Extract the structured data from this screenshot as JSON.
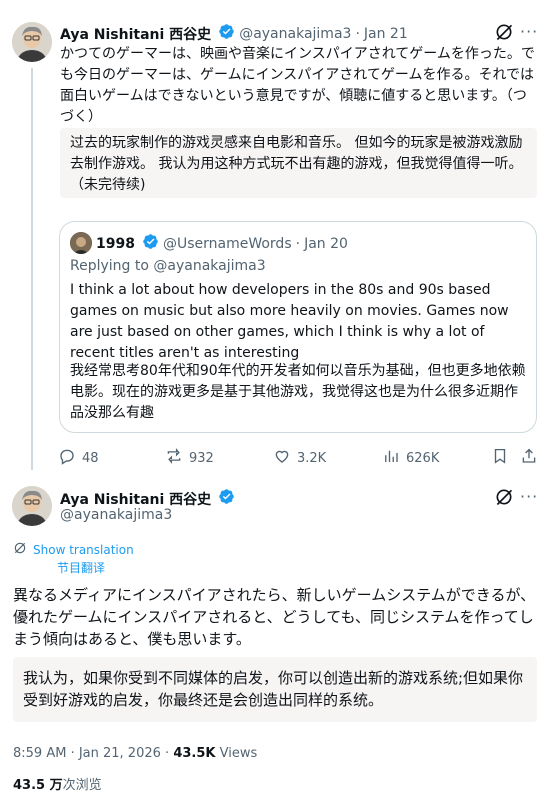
{
  "tweet1": {
    "author_name": "Aya Nishitani 西谷史",
    "handle": "@ayanakajima3",
    "sep": "·",
    "date": "Jan 21",
    "text": "かつてのゲーマーは、映画や音楽にインスパイアされてゲームを作った。でも今日のゲーマーは、ゲームにインスパイアされてゲームを作る。それでは面白いゲームはできないという意見ですが、傾聴に値すると思います。（つづく）",
    "translation": "过去的玩家制作的游戏灵感来自电影和音乐。 但如今的玩家是被游戏激励去制作游戏。 我认为用这种方式玩不出有趣的游戏，但我觉得值得一听。（未完待续)"
  },
  "quote": {
    "author_name": "1998",
    "handle": "@UsernameWords",
    "sep": "·",
    "date": "Jan 20",
    "replying_to": "Replying to @ayanakajima3",
    "text": "I think a lot about how developers in the 80s and 90s based games on music but also more heavily on movies. Games now are just based on other games, which I think is why a lot of recent titles aren't as interesting",
    "translation": "我经常思考80年代和90年代的开发者如何以音乐为基础，但也更多地依赖电影。现在的游戏更多是基于其他游戏，我觉得这也是为什么很多近期作品没那么有趣"
  },
  "actions": {
    "replies": "48",
    "reposts": "932",
    "likes": "3.2K",
    "views": "626K"
  },
  "tweet2": {
    "author_name": "Aya Nishitani 西谷史",
    "handle": "@ayanakajima3",
    "show_translation": "Show translation",
    "show_translation_cn": "节目翻译",
    "text": "異なるメディアにインスパイアされたら、新しいゲームシステムができるが、優れたゲームにインスパイアされると、どうしても、同じシステムを作ってしまう傾向はあると、僕も思います。",
    "translation": "我认为，如果你受到不同媒体的启发，你可以创造出新的游戏系统;但如果你受到好游戏的启发，你最终还是会创造出同样的系统。",
    "time": "8:59 AM · Jan 21, 2026 ·",
    "views_count": "43.5K",
    "views_label": "Views",
    "views_cn_count": "43.5 万",
    "views_cn_label": "次浏览"
  },
  "colors": {
    "blue": "#1d9bf0",
    "muted": "#536471",
    "border": "#cfd9de",
    "translate_bg": "#f7f4f4"
  },
  "icons": [
    "verified-badge-icon",
    "grok-icon",
    "reply-icon",
    "repost-icon",
    "like-icon",
    "views-icon",
    "bookmark-icon",
    "share-icon",
    "translate-icon"
  ]
}
